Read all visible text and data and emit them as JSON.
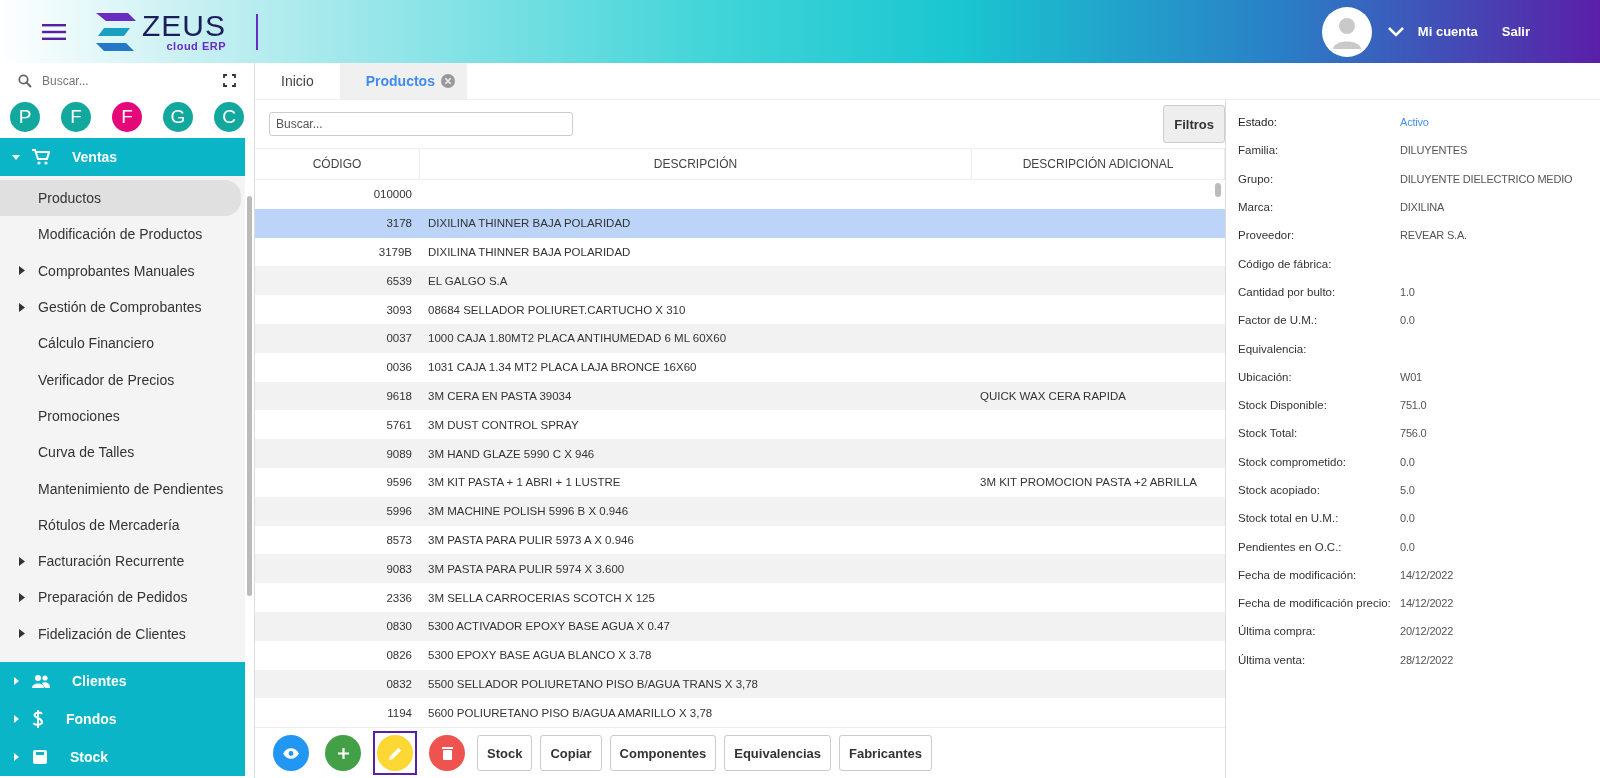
{
  "header": {
    "brand": "ZEUS",
    "brand_subtitle": "cloud ERP",
    "account_link": "Mi cuenta",
    "logout_link": "Salir"
  },
  "sidebar": {
    "search": {
      "placeholder": "Buscar..."
    },
    "shortcuts": [
      {
        "label": "P",
        "color": "#13a89e"
      },
      {
        "label": "F",
        "color": "#13a89e"
      },
      {
        "label": "F",
        "color": "#e5077a"
      },
      {
        "label": "G",
        "color": "#13a89e"
      },
      {
        "label": "C",
        "color": "#13a89e"
      }
    ],
    "sections": [
      {
        "label": "Ventas",
        "kind": "cart",
        "expanded": true,
        "items": [
          {
            "label": "Productos",
            "selected": true,
            "expandable": false
          },
          {
            "label": "Modificación de Productos",
            "selected": false,
            "expandable": false
          },
          {
            "label": "Comprobantes Manuales",
            "selected": false,
            "expandable": true
          },
          {
            "label": "Gestión de Comprobantes",
            "selected": false,
            "expandable": true
          },
          {
            "label": "Cálculo Financiero",
            "selected": false,
            "expandable": false
          },
          {
            "label": "Verificador de Precios",
            "selected": false,
            "expandable": false
          },
          {
            "label": "Promociones",
            "selected": false,
            "expandable": false
          },
          {
            "label": "Curva de Talles",
            "selected": false,
            "expandable": false
          },
          {
            "label": "Mantenimiento de Pendientes",
            "selected": false,
            "expandable": false
          },
          {
            "label": "Rótulos de Mercadería",
            "selected": false,
            "expandable": false
          },
          {
            "label": "Facturación Recurrente",
            "selected": false,
            "expandable": true
          },
          {
            "label": "Preparación de Pedidos",
            "selected": false,
            "expandable": true
          },
          {
            "label": "Fidelización de Clientes",
            "selected": false,
            "expandable": true
          }
        ]
      },
      {
        "label": "Clientes",
        "kind": "people",
        "expanded": false
      },
      {
        "label": "Fondos",
        "kind": "dollar",
        "expanded": false
      },
      {
        "label": "Stock",
        "kind": "box",
        "expanded": false
      }
    ]
  },
  "tabs": [
    {
      "label": "Inicio",
      "selected": false,
      "closable": false
    },
    {
      "label": "Productos",
      "selected": true,
      "closable": true
    }
  ],
  "search": {
    "placeholder": "Buscar..."
  },
  "filter_button": "Filtros",
  "table": {
    "columns": [
      "CÓDIGO",
      "DESCRIPCIÓN",
      "DESCRIPCIÓN ADICIONAL"
    ],
    "rows": [
      {
        "code": "010000",
        "selected": false
      },
      {
        "code": "3178",
        "description": "DIXILINA THINNER BAJA POLARIDAD",
        "selected": true
      },
      {
        "code": "3179B",
        "description": "DIXILINA THINNER BAJA POLARIDAD",
        "selected": false
      },
      {
        "code": "6539",
        "description": "EL GALGO S.A",
        "selected": false
      },
      {
        "code": "3093",
        "description": "08684 SELLADOR POLIURET.CARTUCHO X 310",
        "selected": false
      },
      {
        "code": "0037",
        "description": "1000 CAJA 1.80MT2 PLACA ANTIHUMEDAD 6 ML 60X60",
        "selected": false
      },
      {
        "code": "0036",
        "description": "1031 CAJA 1.34 MT2 PLACA LAJA BRONCE 16X60",
        "selected": false
      },
      {
        "code": "9618",
        "description": "3M CERA EN PASTA 39034",
        "extra": "QUICK WAX CERA RAPIDA",
        "selected": false
      },
      {
        "code": "5761",
        "description": "3M DUST CONTROL SPRAY",
        "selected": false
      },
      {
        "code": "9089",
        "description": "3M HAND GLAZE 5990 C X 946",
        "selected": false
      },
      {
        "code": "9596",
        "description": "3M KIT PASTA + 1 ABRI + 1 LUSTRE",
        "extra": "3M KIT PROMOCION PASTA +2 ABRILLA",
        "selected": false
      },
      {
        "code": "5996",
        "description": "3M MACHINE POLISH 5996 B X 0.946",
        "selected": false
      },
      {
        "code": "8573",
        "description": "3M PASTA PARA PULIR 5973 A X 0.946",
        "selected": false
      },
      {
        "code": "9083",
        "description": "3M PASTA PARA PULIR 5974 X 3.600",
        "selected": false
      },
      {
        "code": "2336",
        "description": "3M SELLA CARROCERIAS SCOTCH X 125",
        "selected": false
      },
      {
        "code": "0830",
        "description": "5300 ACTIVADOR EPOXY BASE AGUA X 0.47",
        "selected": false
      },
      {
        "code": "0826",
        "description": "5300 EPOXY BASE AGUA BLANCO X 3.78",
        "selected": false
      },
      {
        "code": "0832",
        "description": "5500 SELLADOR POLIURETANO PISO B/AGUA TRANS X 3,78",
        "selected": false
      },
      {
        "code": "1194",
        "description": "5600 POLIURETANO PISO B/AGUA AMARILLO X 3,78",
        "selected": false
      }
    ]
  },
  "details": [
    {
      "label": "Estado:",
      "value": "Activo",
      "kind": "status"
    },
    {
      "label": "Familia:",
      "value": "DILUYENTES",
      "kind": "text"
    },
    {
      "label": "Grupo:",
      "value": "DILUYENTE DIELECTRICO MEDIO",
      "kind": "text"
    },
    {
      "label": "Marca:",
      "value": "DIXILINA",
      "kind": "text"
    },
    {
      "label": "Proveedor:",
      "value": "REVEAR S.A.",
      "kind": "text"
    },
    {
      "label": "Código de fábrica:",
      "kind": "text"
    },
    {
      "label": "Cantidad por bulto:",
      "value": "1.0",
      "kind": "text"
    },
    {
      "label": "Factor de U.M.:",
      "value": "0.0",
      "kind": "text"
    },
    {
      "label": "Equivalencia:",
      "kind": "text"
    },
    {
      "label": "Ubicación:",
      "value": "W01",
      "kind": "text"
    },
    {
      "label": "Stock Disponible:",
      "value": "751.0",
      "kind": "text"
    },
    {
      "label": "Stock Total:",
      "value": "756.0",
      "kind": "text"
    },
    {
      "label": "Stock comprometido:",
      "value": "0.0",
      "kind": "text"
    },
    {
      "label": "Stock acopiado:",
      "value": "5.0",
      "kind": "text"
    },
    {
      "label": "Stock total en U.M.:",
      "value": "0.0",
      "kind": "text"
    },
    {
      "label": "Pendientes en O.C.:",
      "value": "0.0",
      "kind": "text"
    },
    {
      "label": "Fecha de modificación:",
      "value": "14/12/2022",
      "kind": "text"
    },
    {
      "label": "Fecha de modificación precio:",
      "value": "14/12/2022",
      "kind": "text"
    },
    {
      "label": "Última compra:",
      "value": "20/12/2022",
      "kind": "text"
    },
    {
      "label": "Última venta:",
      "value": "28/12/2022",
      "kind": "text"
    }
  ],
  "actions": [
    {
      "kind": "view",
      "focused": false
    },
    {
      "kind": "add",
      "focused": false
    },
    {
      "kind": "edit",
      "focused": true
    },
    {
      "kind": "delete",
      "focused": false
    }
  ],
  "buttons": [
    "Stock",
    "Copiar",
    "Componentes",
    "Equivalencias",
    "Fabricantes"
  ]
}
